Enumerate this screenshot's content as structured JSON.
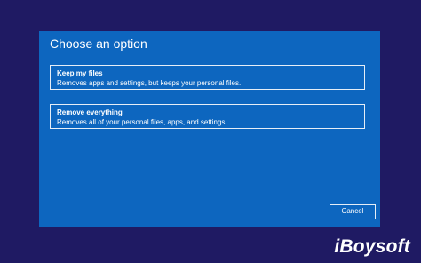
{
  "dialog": {
    "title": "Choose an option",
    "options": [
      {
        "title": "Keep my files",
        "description": "Removes apps and settings, but keeps your personal files."
      },
      {
        "title": "Remove everything",
        "description": "Removes all of your personal files, apps, and settings."
      }
    ],
    "cancel_label": "Cancel"
  },
  "watermark": "iBoysoft",
  "colors": {
    "background": "#1f1a63",
    "dialog": "#0d66bf",
    "text": "#ffffff",
    "border": "#e6eef7"
  }
}
